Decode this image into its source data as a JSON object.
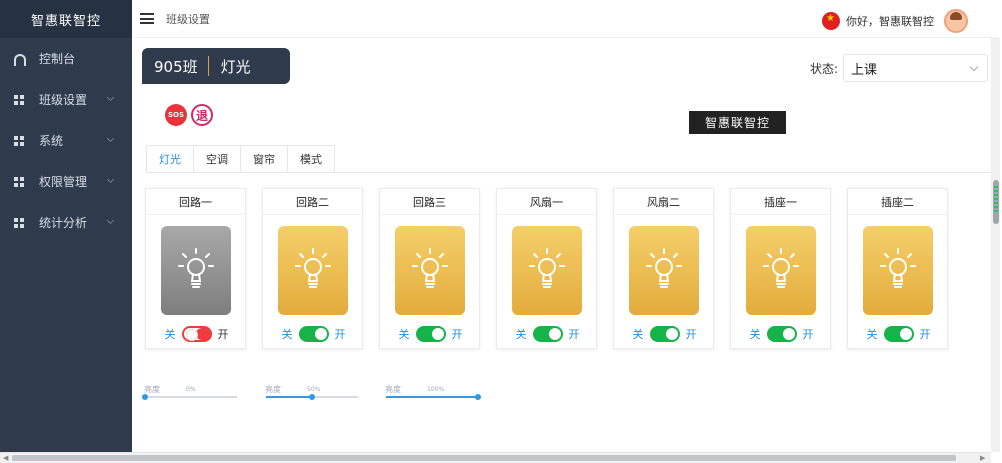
{
  "app": {
    "logo": "智惠联智控"
  },
  "header": {
    "breadcrumb": "班级设置",
    "greeting": "你好，智惠联智控"
  },
  "sidebar": {
    "items": [
      {
        "label": "控制台",
        "icon": "dashboard-icon"
      },
      {
        "label": "班级设置",
        "icon": "grid-icon"
      },
      {
        "label": "系统",
        "icon": "grid-icon"
      },
      {
        "label": "权限管理",
        "icon": "grid-icon"
      },
      {
        "label": "统计分析",
        "icon": "grid-icon"
      }
    ]
  },
  "room": {
    "class": "905班",
    "label": "灯光"
  },
  "status": {
    "label": "状态:",
    "value": "上课"
  },
  "actions": {
    "sos": "SOS",
    "exit": "退"
  },
  "tooltip": {
    "text": "智惠联智控"
  },
  "tabs": [
    {
      "label": "灯光",
      "active": true
    },
    {
      "label": "空调",
      "active": false
    },
    {
      "label": "窗帘",
      "active": false
    },
    {
      "label": "模式",
      "active": false
    }
  ],
  "devices": [
    {
      "name": "回路一",
      "state": "off",
      "off_label": "关",
      "on_label": "开"
    },
    {
      "name": "回路二",
      "state": "on",
      "off_label": "关",
      "on_label": "开"
    },
    {
      "name": "回路三",
      "state": "on",
      "off_label": "关",
      "on_label": "开"
    },
    {
      "name": "风扇一",
      "state": "on",
      "off_label": "关",
      "on_label": "开"
    },
    {
      "name": "风扇二",
      "state": "on",
      "off_label": "关",
      "on_label": "开"
    },
    {
      "name": "插座一",
      "state": "on",
      "off_label": "关",
      "on_label": "开"
    },
    {
      "name": "插座二",
      "state": "on",
      "off_label": "关",
      "on_label": "开"
    }
  ],
  "sliders": [
    {
      "label": "亮度",
      "value_text": "0%",
      "value": 0
    },
    {
      "label": "亮度",
      "value_text": "50%",
      "value": 50
    },
    {
      "label": "亮度",
      "value_text": "100%",
      "value": 100
    }
  ],
  "colors": {
    "sidebar_bg": "#2f3b4c",
    "accent_blue": "#1e8fd6",
    "switch_on": "#15b34a",
    "switch_off": "#ef3d3d",
    "bulb_on": "#e3ac3c",
    "bulb_off": "#8c8c8c"
  }
}
